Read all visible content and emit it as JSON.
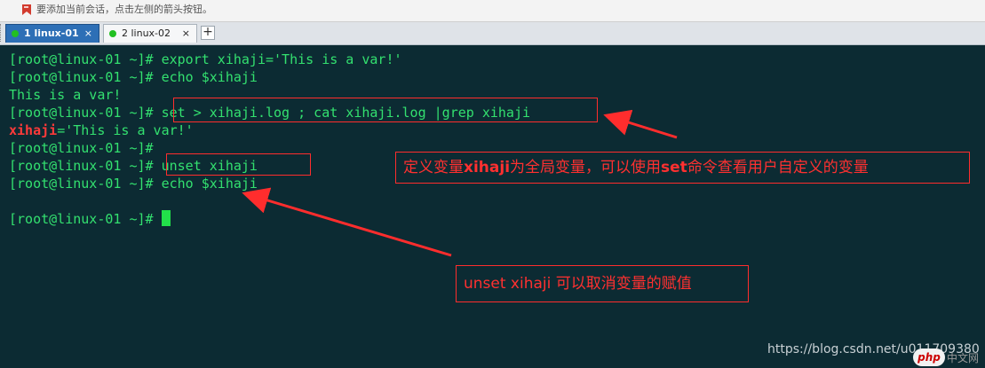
{
  "hint": {
    "text": "要添加当前会话，点击左侧的箭头按钮。"
  },
  "tabs": [
    {
      "label": "1 linux-01",
      "close": "×"
    },
    {
      "label": "2 linux-02",
      "close": "×"
    }
  ],
  "tab_add": "+",
  "terminal": {
    "lines": [
      "[root@linux-01 ~]# export xihaji='This is a var!'",
      "[root@linux-01 ~]# echo $xihaji",
      "This is a var!",
      "[root@linux-01 ~]# set > xihaji.log ; cat xihaji.log |grep xihaji",
      {
        "var": "xihaji",
        "rest": "='This is a var!'"
      },
      "[root@linux-01 ~]#",
      "[root@linux-01 ~]# unset xihaji",
      "[root@linux-01 ~]# echo $xihaji",
      "",
      "[root@linux-01 ~]# "
    ]
  },
  "annotations": {
    "note1": {
      "pre": "定义变量",
      "bold1": "xihaji",
      "mid": "为全局变量，可以使用",
      "bold2": "set",
      "post": "命令查看用户自定义的变量"
    },
    "note2": {
      "text": "unset xihaji 可以取消变量的赋值"
    }
  },
  "watermark": {
    "text": "https://blog.csdn.net/u011709380",
    "logo": "php",
    "logo_suffix": "中文网"
  },
  "colors": {
    "terminal_bg": "#0c2b33",
    "terminal_text": "#33e06f",
    "annotation": "#ff2d2d",
    "active_tab": "#2d6fb6"
  }
}
